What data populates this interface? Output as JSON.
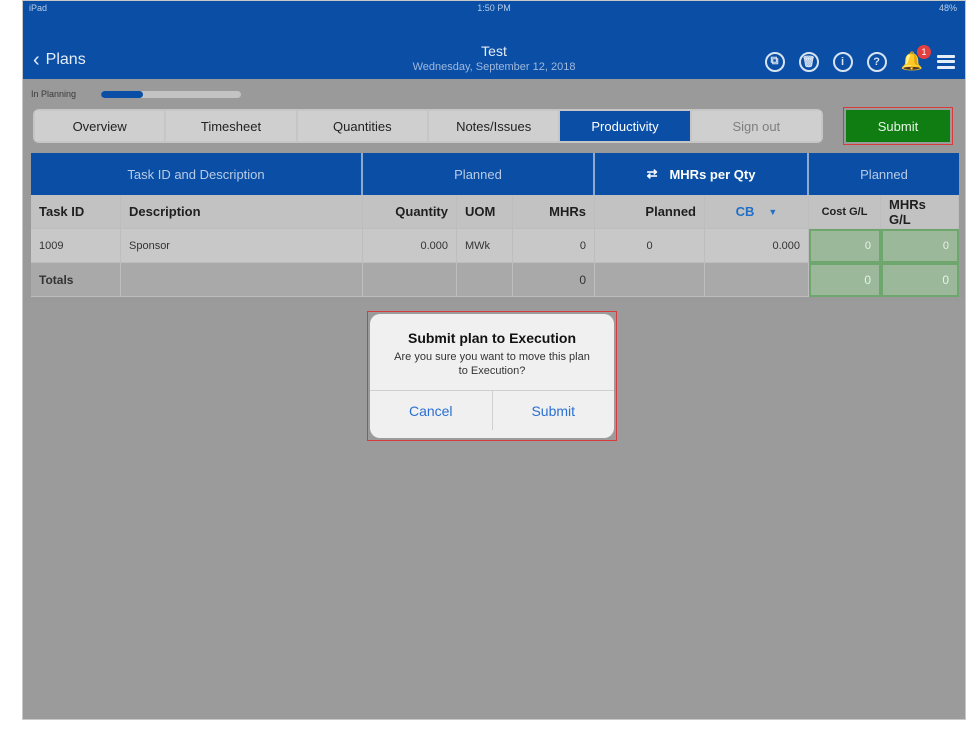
{
  "status_bar": {
    "left": "iPad",
    "time": "1:50 PM",
    "battery": "48%"
  },
  "nav": {
    "back_label": "Plans",
    "title": "Test",
    "subtitle": "Wednesday, September 12, 2018",
    "notification_count": "1"
  },
  "planning": {
    "label": "In Planning",
    "progress": 0.3
  },
  "tabs": [
    {
      "label": "Overview"
    },
    {
      "label": "Timesheet"
    },
    {
      "label": "Quantities"
    },
    {
      "label": "Notes/Issues"
    },
    {
      "label": "Productivity"
    },
    {
      "label": "Sign out"
    }
  ],
  "submit_label": "Submit",
  "table": {
    "group_headers": [
      "Task ID and Description",
      "Planned",
      "MHRs per Qty",
      "Planned"
    ],
    "columns": [
      "Task ID",
      "Description",
      "Quantity",
      "UOM",
      "MHRs",
      "Planned",
      "CB",
      "Cost G/L",
      "MHRs G/L"
    ],
    "row": {
      "task_id": "1009",
      "description": "Sponsor",
      "quantity": "0.000",
      "uom": "MWk",
      "mhrs": "0",
      "planned": "0",
      "cb_value": "0.000",
      "cost_gl": "0",
      "mhrs_gl": "0"
    },
    "totals": {
      "label": "Totals",
      "mhrs": "0",
      "cost_gl": "0",
      "mhrs_gl": "0"
    }
  },
  "dialog": {
    "title": "Submit plan to Execution",
    "message": "Are you sure you want to move this plan to Execution?",
    "cancel": "Cancel",
    "confirm": "Submit"
  },
  "colors": {
    "primary": "#0a4fa5",
    "submit": "#0f7d12",
    "highlight": "#d93a3a"
  }
}
